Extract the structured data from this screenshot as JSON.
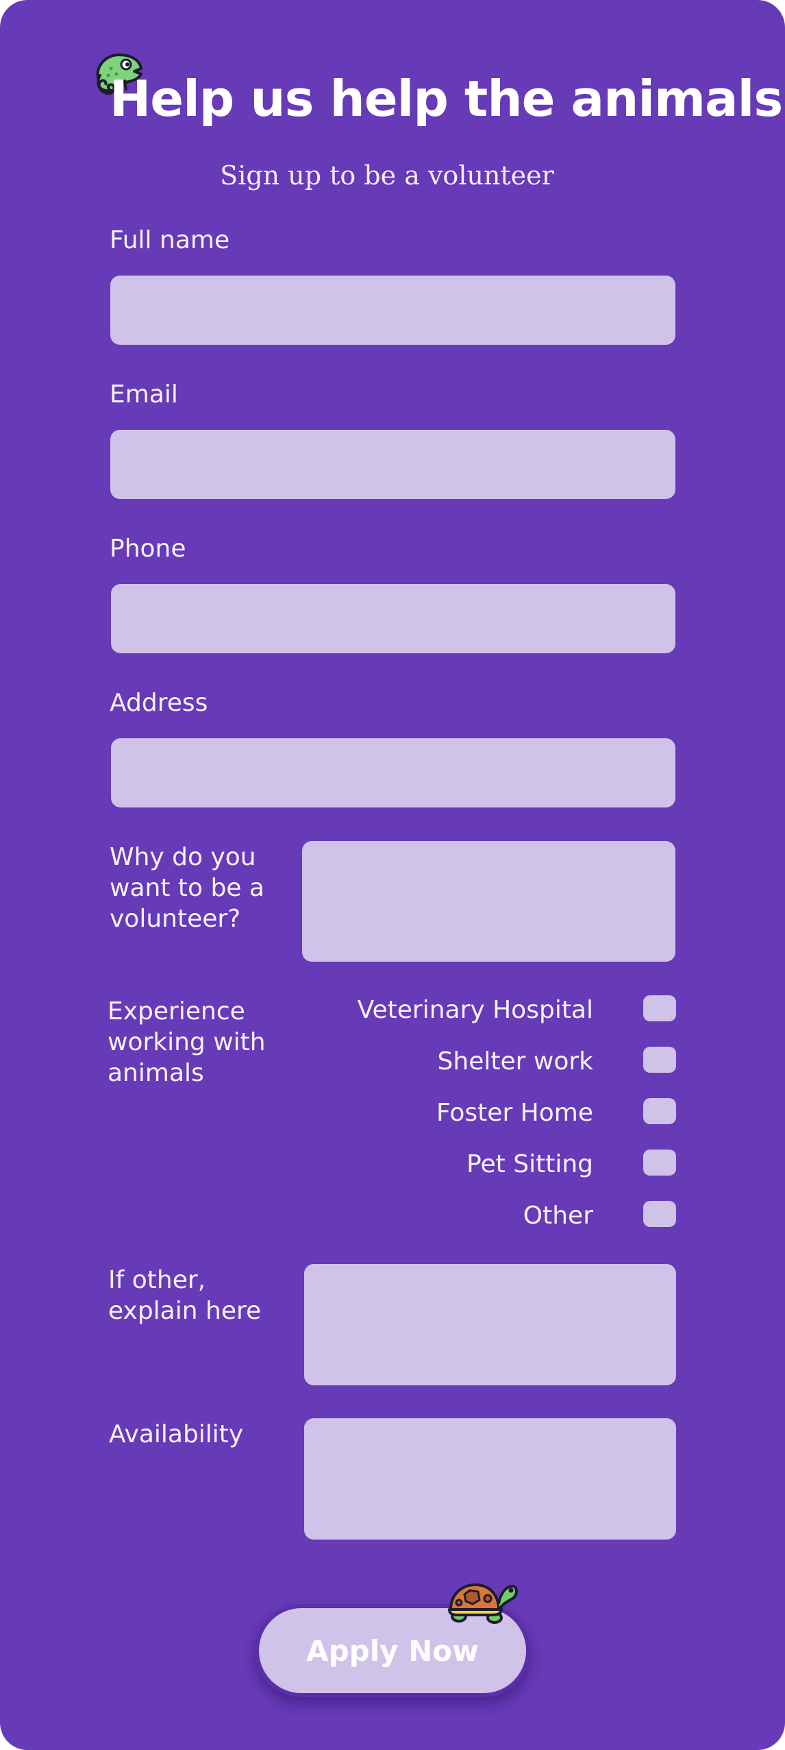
{
  "header": {
    "title": "Help us help the animals",
    "subtitle": "Sign up to be a volunteer",
    "mascot_icon": "chameleon-icon"
  },
  "form": {
    "full_name": {
      "label": "Full name",
      "value": ""
    },
    "email": {
      "label": "Email",
      "value": ""
    },
    "phone": {
      "label": "Phone",
      "value": ""
    },
    "address": {
      "label": "Address",
      "value": ""
    },
    "why_volunteer": {
      "label": "Why do you want to be a volunteer?",
      "value": ""
    },
    "experience": {
      "label": "Experience working with animals",
      "options": [
        {
          "label": "Veterinary Hospital",
          "checked": false
        },
        {
          "label": "Shelter work",
          "checked": false
        },
        {
          "label": "Foster Home",
          "checked": false
        },
        {
          "label": "Pet Sitting",
          "checked": false
        },
        {
          "label": "Other",
          "checked": false
        }
      ]
    },
    "other_explain": {
      "label": "If other, explain here",
      "value": ""
    },
    "availability": {
      "label": "Availability",
      "value": ""
    }
  },
  "submit": {
    "label": "Apply Now",
    "decoration_icon": "turtle-icon"
  },
  "colors": {
    "card_background": "#673ab7",
    "field_background": "#d0c3ea",
    "text": "#ffffff"
  }
}
